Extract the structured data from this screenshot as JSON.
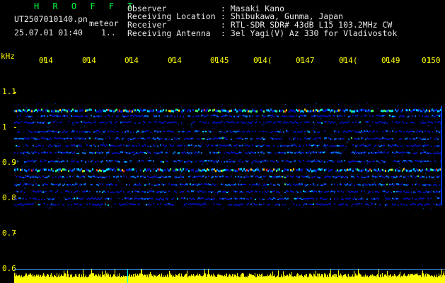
{
  "header": {
    "app_title": "H R O F F T",
    "filename": "UT2507010140.pn",
    "mode": "meteor",
    "datetime": "25.07.01 01:40",
    "extra": "1..",
    "fields": [
      {
        "label": "Observer",
        "value": ": Masaki Kano"
      },
      {
        "label": "Receiving Location",
        "value": ": Shibukawa, Gunma, Japan"
      },
      {
        "label": "Receiver",
        "value": ": RTL-SDR SDR# 43dB L15 103.2MHz CW"
      },
      {
        "label": "Receiving Antenna",
        "value": ": 3el Yagi(V) Az 330 for Vladivostok"
      }
    ]
  },
  "spectrogram": {
    "y_unit": "kHz",
    "y_ticks": [
      "1.1",
      "1",
      "0.9",
      "0.8",
      "0.7",
      "0.6"
    ],
    "x_ticks": [
      "014",
      "014",
      "014",
      "014",
      "0145",
      "014(",
      "0147",
      "014(",
      "0149",
      "0150"
    ],
    "colors": {
      "text_header": "#e8e8e8",
      "title": "#00ff3c",
      "axis": "#ffff00",
      "background": "#000000",
      "noise_low": "#0000b4",
      "noise_mid": "#00c8ff",
      "signal_high": "#ff2020"
    }
  }
}
